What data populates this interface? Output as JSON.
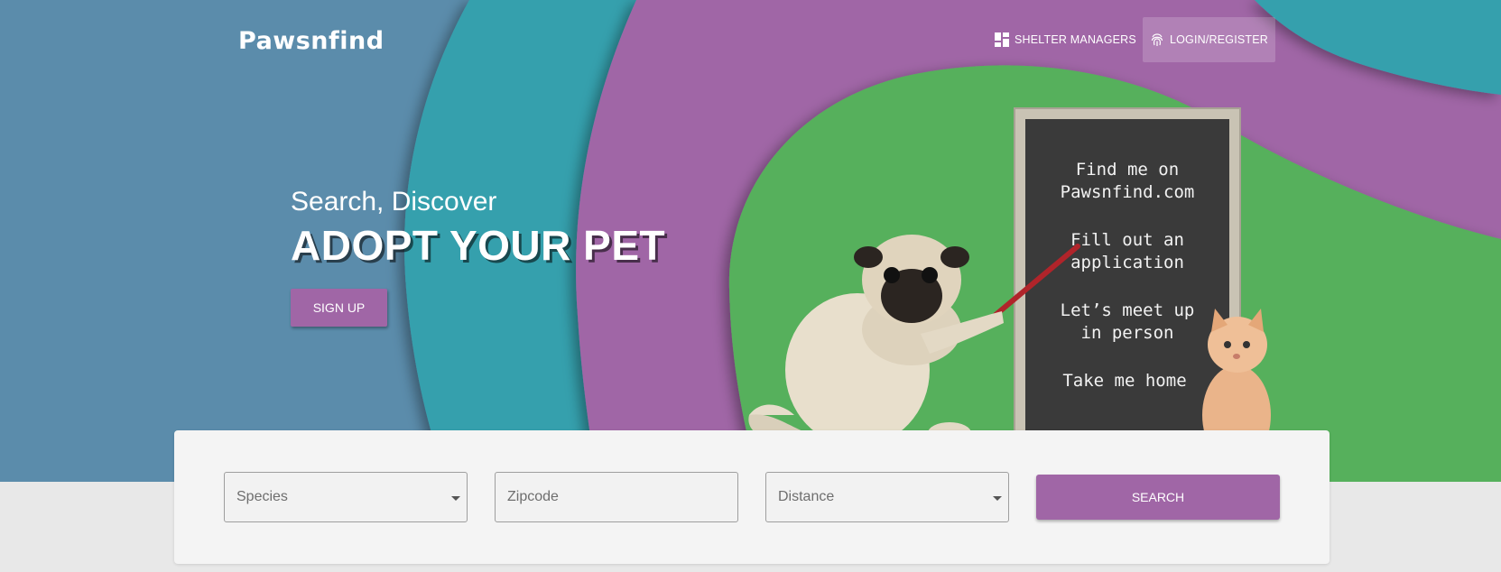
{
  "brand": {
    "name": "Pawsnfind"
  },
  "nav": {
    "shelter_label": "SHELTER MANAGERS",
    "login_label": "LOGIN/REGISTER"
  },
  "hero": {
    "tagline": "Search, Discover",
    "headline": "ADOPT YOUR PET",
    "signup_label": "SIGN UP",
    "chalkboard": [
      "Find me on",
      "Pawsnfind.com",
      "Fill out an",
      "application",
      "Let’s meet up",
      "in person",
      "Take me home"
    ]
  },
  "search": {
    "species_placeholder": "Species",
    "zipcode_placeholder": "Zipcode",
    "distance_placeholder": "Distance",
    "button_label": "SEARCH"
  },
  "colors": {
    "blue": "#5b8cab",
    "teal": "#35a0ad",
    "purple": "#a066a6",
    "green": "#57b05b"
  }
}
